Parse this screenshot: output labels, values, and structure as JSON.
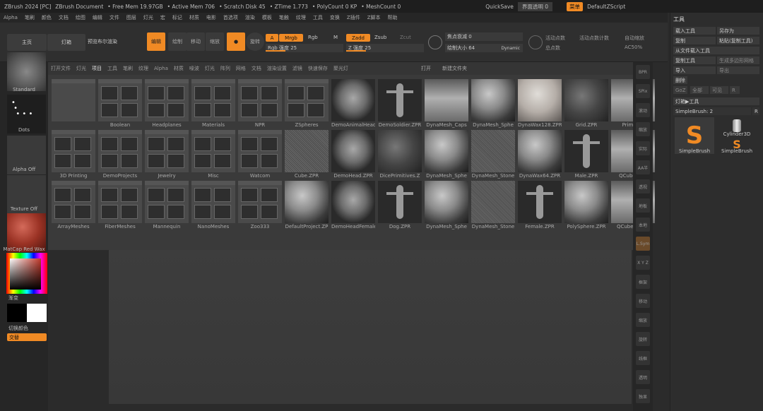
{
  "titlebar": {
    "app": "ZBrush 2024 [PC]",
    "document": "ZBrush Document",
    "free_mem": "• Free Mem 19.97GB",
    "active_mem": "• Active Mem 706",
    "scratch": "• Scratch Disk 45",
    "ztime": "• ZTime 1.773",
    "polycount": "• PolyCount 0 KP",
    "meshcount": "• MeshCount 0",
    "quicksave": "QuickSave",
    "transparency": "界面透明 0",
    "menus_btn": "菜单",
    "script": "DefaultZScript"
  },
  "menubar": [
    "Alpha",
    "笔刷",
    "颜色",
    "文档",
    "绘图",
    "编辑",
    "文件",
    "图层",
    "灯光",
    "宏",
    "标记",
    "材质",
    "电影",
    "首选项",
    "渲染",
    "模板",
    "笔触",
    "纹理",
    "工具",
    "变换",
    "Z插件",
    "Z脚本",
    "帮助"
  ],
  "toolbar": {
    "home": "主页",
    "lightbox": "灯箱",
    "preview": "预览布尔渲染",
    "edit": "编辑",
    "draw": "绘制",
    "move": "移动",
    "scale": "缩放",
    "rotate": "旋转",
    "a": "A",
    "mrgb": "Mrgb",
    "rgb": "Rgb",
    "m": "M",
    "zadd": "Zadd",
    "zsub": "Zsub",
    "zcut": "Zcut",
    "rgb_intensity": "Rgb 强度 25",
    "z_intensity": "Z 强度 25",
    "focal_shift": "焦点衰减 0",
    "draw_size": "绘制大小 64",
    "dynamic": "Dynamic",
    "active_points": "活动点数",
    "total_points": "总点数",
    "active_points_count": "活动点数计数",
    "auto_zoom": "自动缩放",
    "ac50": "AC50%"
  },
  "leftshelf": {
    "brush": "Standard",
    "stroke": "Dots",
    "alpha": "Alpha Off",
    "texture": "Texture Off",
    "material": "MatCap Red Wax",
    "gradient": "渐变",
    "switch_color": "切换颜色",
    "alternate": "交替"
  },
  "lightbox": {
    "tabs": [
      "打开文件",
      "灯光",
      "项目",
      "工具",
      "笔刷",
      "纹理",
      "Alpha",
      "材质",
      "噪波",
      "灯光",
      "阵列",
      "网格",
      "文档",
      "渲染设置",
      "滤镜",
      "快速保存",
      "聚光灯"
    ],
    "open": "打开",
    "new_folder": "新建文件夹",
    "row1": [
      "",
      "Boolean",
      "Headplanes",
      "Materials",
      "NPR",
      "ZSpheres",
      "DemoAnimalHead",
      "DemoSoldier.ZPR",
      "DynaMesh_Caps",
      "DynaMesh_Sphe",
      "DynaWax128.ZPR",
      "Grid.ZPR",
      "Primitive"
    ],
    "row2": [
      "3D Printing",
      "DemoProjects",
      "Jewelry",
      "Misc",
      "Watcom",
      "Cube.ZPR",
      "DemoHead.ZPR",
      "DicePrimitives.Z",
      "DynaMesh_Sphe",
      "DynaMesh_Stone",
      "DynaWax64.ZPR",
      "Male.ZPR",
      "QCube.ZPR"
    ],
    "row3": [
      "ArrayMeshes",
      "FiberMeshes",
      "Mannequin",
      "NanoMeshes",
      "Zoo333",
      "DefaultProject.ZP",
      "DemoHeadFemale",
      "Dog.ZPR",
      "DynaMesh_Sphe",
      "DynaMesh_Stone",
      "Female.ZPR",
      "PolySphere.ZPR",
      "QCube3Stars"
    ]
  },
  "rightshelf": [
    "BPR",
    "SPix",
    "滚动",
    "缩放",
    "实际",
    "AA半",
    "透视",
    "地板",
    "本地",
    "L.Sym",
    "X Y Z",
    "框架",
    "移动",
    "缩放",
    "旋转",
    "线框",
    "透明",
    "独显"
  ],
  "toolpalette": {
    "title": "工具",
    "load": "载入工具",
    "save_as": "另存为",
    "copy": "复制",
    "paste": "粘贴(复制工具)",
    "import": "从文件载入工具",
    "clone": "复制工具",
    "make_polymesh": "生成多边形网格",
    "import2": "导入",
    "export": "导出",
    "delete": "删除",
    "goz": "GoZ",
    "all": "全部",
    "visible": "可见",
    "r": "R",
    "lightbox_tools": "灯箱▶工具",
    "current": "SimpleBrush: 2",
    "brush1": "SimpleBrush",
    "brush2": "SimpleBrush",
    "cylinder": "Cylinder3D",
    "n2": "2",
    "n3": "3",
    "r2": "R"
  },
  "colors": {
    "accent": "#f08a24",
    "bg": "#2b2b2b"
  }
}
